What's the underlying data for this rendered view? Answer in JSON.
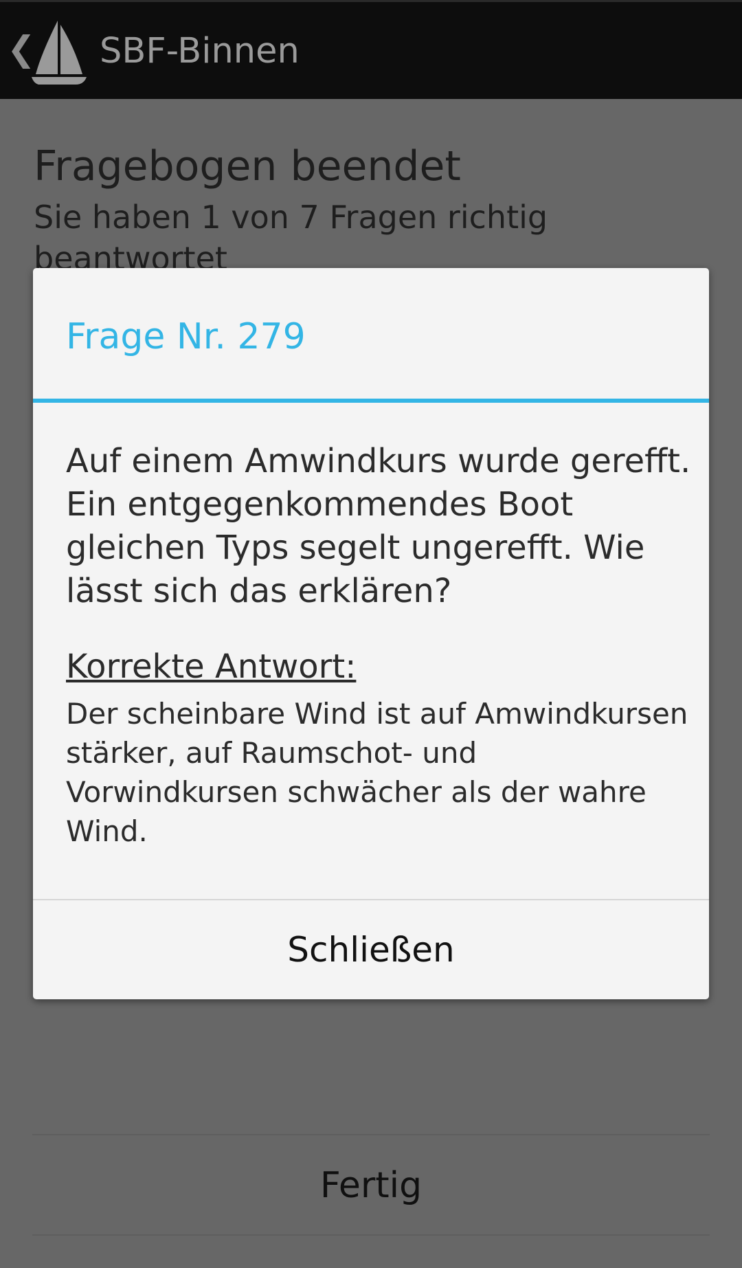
{
  "actionbar": {
    "back_icon": "chevron-left-icon",
    "app_icon": "sailboat-icon",
    "title": "SBF-Binnen"
  },
  "background": {
    "title": "Fragebogen beendet",
    "subtitle": "Sie haben 1 von 7 Fragen richtig beantwortet",
    "done_button": "Fertig"
  },
  "dialog": {
    "title": "Frage Nr. 279",
    "question": "Auf einem Amwindkurs wurde gerefft. Ein entgegenkommendes Boot gleichen Typs segelt ungerefft. Wie lässt sich das erklären?",
    "answer_heading": "Korrekte Antwort:",
    "answer": "Der scheinbare Wind ist auf Amwindkursen stärker, auf Raumschot- und Vorwindkursen schwächer als der wahre Wind.",
    "close_button": "Schließen"
  },
  "colors": {
    "accent": "#33b5e5",
    "actionbar_bg": "#0d0d0d",
    "dim_overlay_bg": "#676767",
    "dialog_bg": "#f4f4f4"
  }
}
